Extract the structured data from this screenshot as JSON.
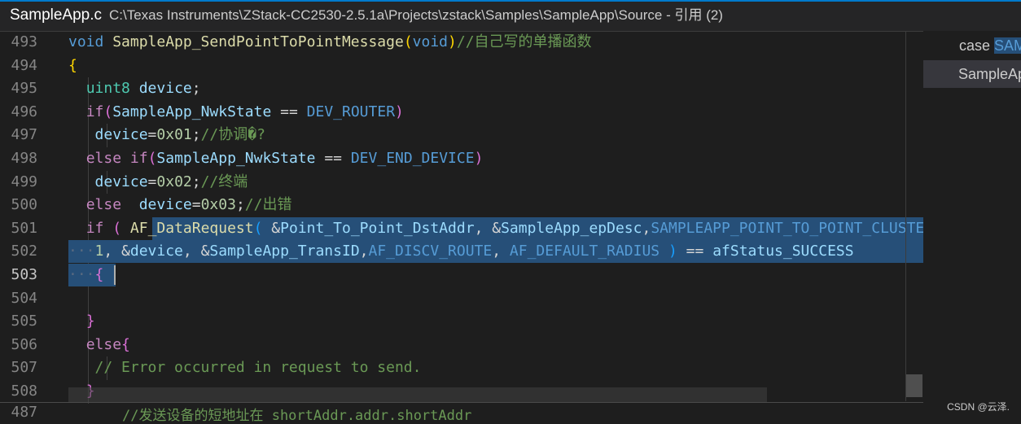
{
  "title_bar": {
    "file_name": "SampleApp.c",
    "path": "C:\\Texas Instruments\\ZStack-CC2530-2.5.1a\\Projects\\zstack\\Samples\\SampleApp\\Source",
    "suffix": " - 引用 (2)"
  },
  "editor": {
    "active_line": 503,
    "lines": [
      {
        "no": 493,
        "tokens": [
          [
            "kw",
            "void "
          ],
          [
            "fn",
            "SampleApp_SendPointToPointMessage"
          ],
          [
            "p1",
            "("
          ],
          [
            "kw",
            "void"
          ],
          [
            "p1",
            ")"
          ],
          [
            "com",
            "//自己写的单播函数"
          ]
        ]
      },
      {
        "no": 494,
        "tokens": [
          [
            "p1",
            "{"
          ]
        ]
      },
      {
        "no": 495,
        "tokens": [
          [
            "op",
            "  "
          ],
          [
            "ty",
            "uint8 "
          ],
          [
            "var",
            "device"
          ],
          [
            "op",
            ";"
          ]
        ]
      },
      {
        "no": 496,
        "tokens": [
          [
            "op",
            "  "
          ],
          [
            "kw2",
            "if"
          ],
          [
            "p2",
            "("
          ],
          [
            "var",
            "SampleApp_NwkState"
          ],
          [
            "op",
            " == "
          ],
          [
            "mac",
            "DEV_ROUTER"
          ],
          [
            "p2",
            ")"
          ]
        ]
      },
      {
        "no": 497,
        "tokens": [
          [
            "op",
            "   "
          ],
          [
            "var",
            "device"
          ],
          [
            "op",
            "="
          ],
          [
            "num",
            "0x01"
          ],
          [
            "op",
            ";"
          ],
          [
            "com",
            "//协调�?"
          ]
        ]
      },
      {
        "no": 498,
        "tokens": [
          [
            "op",
            "  "
          ],
          [
            "kw2",
            "else "
          ],
          [
            "kw2",
            "if"
          ],
          [
            "p2",
            "("
          ],
          [
            "var",
            "SampleApp_NwkState"
          ],
          [
            "op",
            " == "
          ],
          [
            "mac",
            "DEV_END_DEVICE"
          ],
          [
            "p2",
            ")"
          ]
        ]
      },
      {
        "no": 499,
        "tokens": [
          [
            "op",
            "   "
          ],
          [
            "var",
            "device"
          ],
          [
            "op",
            "="
          ],
          [
            "num",
            "0x02"
          ],
          [
            "op",
            ";"
          ],
          [
            "com",
            "//终端"
          ]
        ]
      },
      {
        "no": 500,
        "tokens": [
          [
            "op",
            "  "
          ],
          [
            "kw2",
            "else  "
          ],
          [
            "var",
            "device"
          ],
          [
            "op",
            "="
          ],
          [
            "num",
            "0x03"
          ],
          [
            "op",
            ";"
          ],
          [
            "com",
            "//出错"
          ]
        ]
      },
      {
        "no": 501,
        "tokens": [
          [
            "op",
            "  "
          ],
          [
            "kw2",
            "if "
          ],
          [
            "p2",
            "( "
          ],
          [
            "fn",
            "AF_DataRequest"
          ],
          [
            "p3",
            "( "
          ],
          [
            "op",
            "&"
          ],
          [
            "var",
            "Point_To_Point_DstAddr"
          ],
          [
            "op",
            ", &"
          ],
          [
            "var",
            "SampleApp_epDesc"
          ],
          [
            "op",
            ","
          ],
          [
            "mac",
            "SAMPLEAPP_POINT_TO_POINT_CLUSTERID"
          ]
        ]
      },
      {
        "no": 502,
        "tokens": [
          [
            "dots",
            "···"
          ],
          [
            "num",
            "1"
          ],
          [
            "op",
            ", &"
          ],
          [
            "var",
            "device"
          ],
          [
            "op",
            ", &"
          ],
          [
            "var",
            "SampleApp_TransID"
          ],
          [
            "op",
            ","
          ],
          [
            "mac",
            "AF_DISCV_ROUTE"
          ],
          [
            "op",
            ", "
          ],
          [
            "mac",
            "AF_DEFAULT_RADIUS "
          ],
          [
            "p3",
            ")"
          ],
          [
            "op",
            " == "
          ],
          [
            "var",
            "afStatus_SUCCESS"
          ]
        ]
      },
      {
        "no": 503,
        "tokens": [
          [
            "dots",
            "···"
          ],
          [
            "p2",
            "{"
          ]
        ]
      },
      {
        "no": 504,
        "tokens": [
          [
            "op",
            ""
          ]
        ]
      },
      {
        "no": 505,
        "tokens": [
          [
            "op",
            "  "
          ],
          [
            "p2",
            "}"
          ]
        ]
      },
      {
        "no": 506,
        "tokens": [
          [
            "op",
            "  "
          ],
          [
            "kw2",
            "else"
          ],
          [
            "p2",
            "{"
          ]
        ]
      },
      {
        "no": 507,
        "tokens": [
          [
            "op",
            "   "
          ],
          [
            "com",
            "// Error occurred in request to send."
          ]
        ]
      },
      {
        "no": 508,
        "tokens": [
          [
            "op",
            "  "
          ],
          [
            "p2",
            "}"
          ]
        ]
      }
    ],
    "peek_next_line_no": 487,
    "peek_next_line_text": "//发送设备的短地址在 shortAddr.addr.shortAddr"
  },
  "reference_panel": {
    "items": [
      {
        "prefix": "case ",
        "highlight": "SAMPLEAPP_POINT_TO_POINT_CLUSTERID:",
        "selected": false
      },
      {
        "prefix": "SampleApp_SendPointToPointMessage();",
        "highlight": "",
        "selected": true
      }
    ]
  },
  "watermark": "CSDN @云泽."
}
